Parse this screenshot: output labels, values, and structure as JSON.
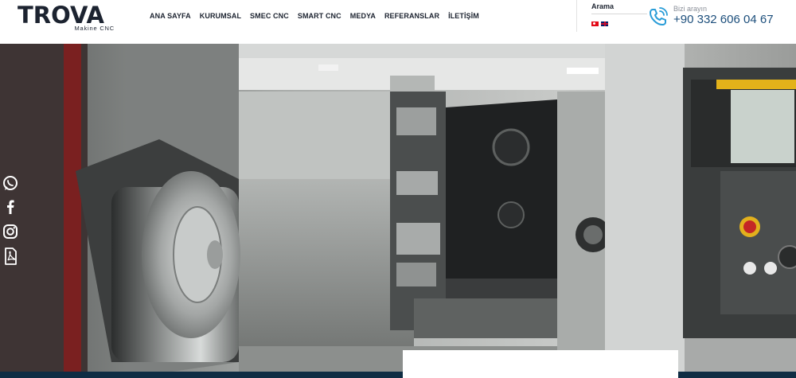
{
  "brand": {
    "name": "TROVA",
    "tagline": "Makine CNC"
  },
  "nav": {
    "items": [
      {
        "label": "ANA SAYFA"
      },
      {
        "label": "KURUMSAL"
      },
      {
        "label": "SMEC CNC"
      },
      {
        "label": "SMART CNC"
      },
      {
        "label": "MEDYA"
      },
      {
        "label": "REFERANSLAR"
      },
      {
        "label": "İLETİŞİM"
      }
    ]
  },
  "search": {
    "label": "Arama"
  },
  "languages": [
    {
      "code": "tr",
      "icon": "flag-tr-icon"
    },
    {
      "code": "en",
      "icon": "flag-en-icon"
    }
  ],
  "contact": {
    "call_label": "Bizi arayın",
    "phone": "+90 332 606 04 67"
  },
  "social": [
    {
      "icon": "whatsapp-icon"
    },
    {
      "icon": "facebook-icon"
    },
    {
      "icon": "instagram-icon"
    },
    {
      "icon": "pdf-icon"
    }
  ],
  "colors": {
    "brand_dark": "#1c2330",
    "accent_blue": "#2a9dd8",
    "phone_blue": "#1d4f7c",
    "footer_band": "#0f2d44"
  }
}
